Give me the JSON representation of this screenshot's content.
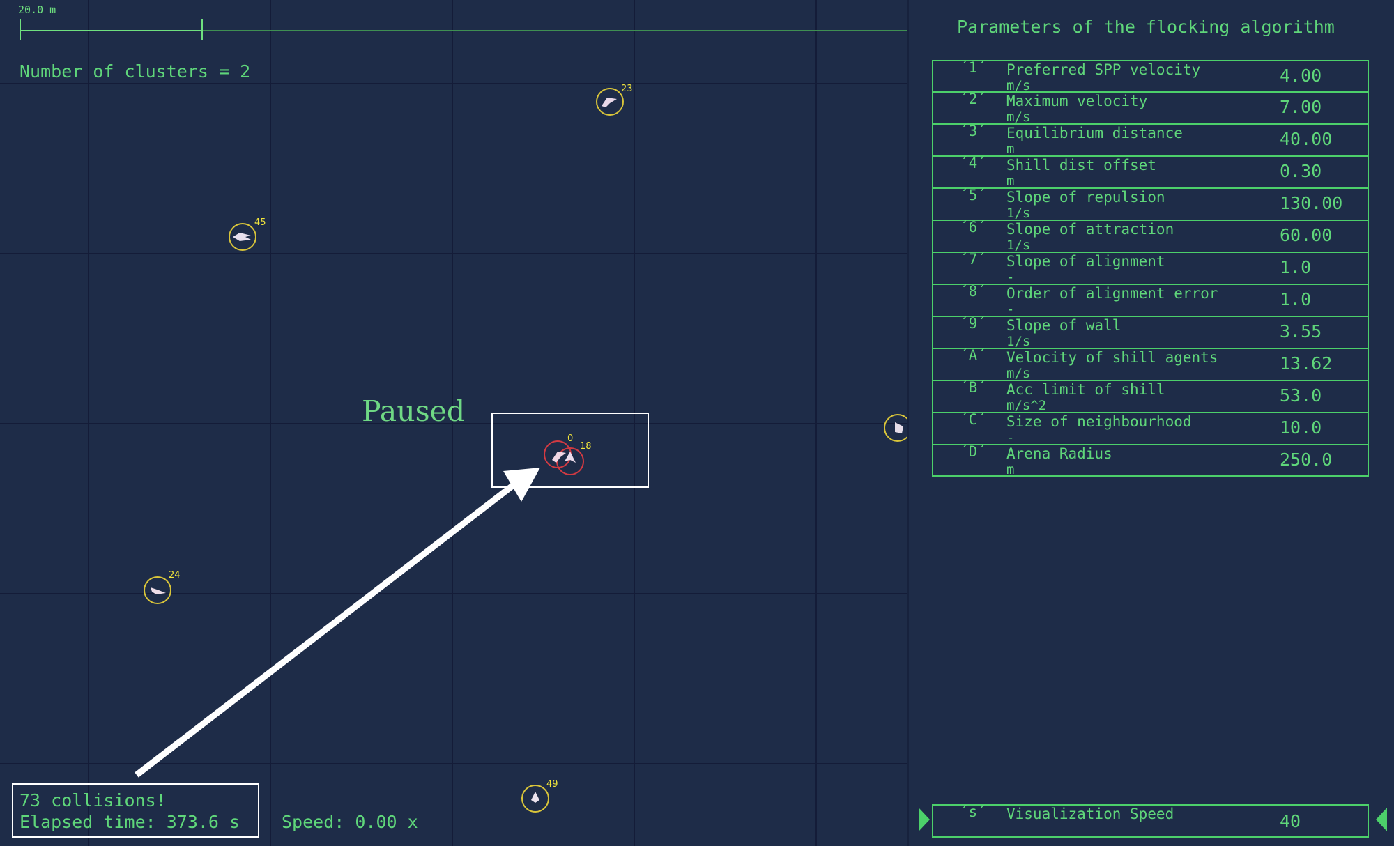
{
  "arena": {
    "scale_label": "20.0 m",
    "clusters_text": "Number of clusters = 2",
    "paused_text": "Paused",
    "agents": [
      {
        "id": "23"
      },
      {
        "id": "45"
      },
      {
        "id": "24"
      },
      {
        "id": "49"
      },
      {
        "id": "0"
      },
      {
        "id": "18"
      }
    ],
    "status": {
      "collisions": "73 collisions!",
      "elapsed": "Elapsed time: 373.6 s",
      "speed": "Speed: 0.00 x"
    }
  },
  "panel": {
    "title": "Parameters of the flocking algorithm",
    "params": [
      {
        "key": "´1´",
        "name": "Preferred SPP velocity",
        "unit": "m/s",
        "value": "4.00"
      },
      {
        "key": "´2´",
        "name": "Maximum velocity",
        "unit": "m/s",
        "value": "7.00"
      },
      {
        "key": "´3´",
        "name": "Equilibrium distance",
        "unit": "m",
        "value": "40.00"
      },
      {
        "key": "´4´",
        "name": "Shill dist offset",
        "unit": "m",
        "value": "0.30"
      },
      {
        "key": "´5´",
        "name": "Slope of repulsion",
        "unit": "1/s",
        "value": "130.00"
      },
      {
        "key": "´6´",
        "name": "Slope of attraction",
        "unit": "1/s",
        "value": "60.00"
      },
      {
        "key": "´7´",
        "name": "Slope of alignment",
        "unit": "-",
        "value": "1.0"
      },
      {
        "key": "´8´",
        "name": "Order of alignment error",
        "unit": "-",
        "value": "1.0"
      },
      {
        "key": "´9´",
        "name": "Slope of wall",
        "unit": "1/s",
        "value": "3.55"
      },
      {
        "key": "´A´",
        "name": "Velocity of shill agents",
        "unit": "m/s",
        "value": "13.62"
      },
      {
        "key": "´B´",
        "name": "Acc limit of shill",
        "unit": "m/s^2",
        "value": "53.0"
      },
      {
        "key": "´C´",
        "name": "Size of neighbourhood",
        "unit": "-",
        "value": "10.0"
      },
      {
        "key": "´D´",
        "name": "Arena Radius",
        "unit": "m",
        "value": "250.0"
      }
    ],
    "viz": {
      "key": "´s´",
      "name": "Visualization Speed",
      "value": "40"
    }
  },
  "colors": {
    "background": "#1e2c48",
    "grid": "#141c38",
    "text_green": "#5fd67a",
    "agent_ring": "#d9c53a",
    "agent_ring_collision": "#d23a42",
    "agent_id": "#f2e63c"
  }
}
